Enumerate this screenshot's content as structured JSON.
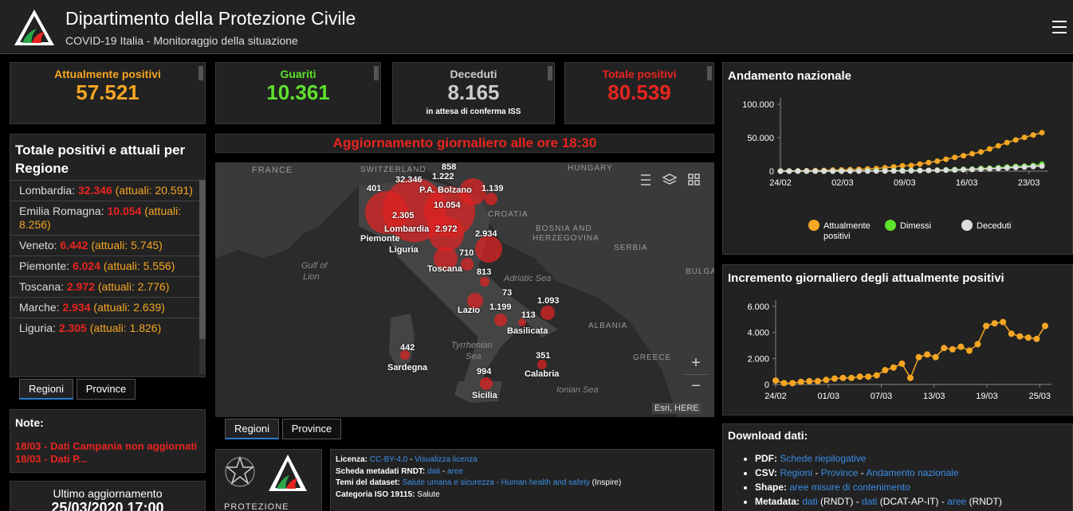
{
  "header": {
    "title": "Dipartimento della Protezione Civile",
    "subtitle": "COVID-19 Italia - Monitoraggio della situazione"
  },
  "kpis": [
    {
      "label": "Attualmente positivi",
      "value": "57.521",
      "color": "#f5a623",
      "note": ""
    },
    {
      "label": "Guariti",
      "value": "10.361",
      "color": "#5ee22c",
      "note": ""
    },
    {
      "label": "Deceduti",
      "value": "8.165",
      "color": "#cccccc",
      "note": "in attesa di conferma ISS"
    },
    {
      "label": "Totale positivi",
      "value": "80.539",
      "color": "#e8241f",
      "note": ""
    }
  ],
  "regions_panel": {
    "title": "Totale positivi e attuali per Regione",
    "actual_prefix": "(attuali: ",
    "actual_suffix": ")",
    "items": [
      {
        "name": "Lombardia",
        "total": "32.346",
        "actual": "20.591"
      },
      {
        "name": "Emilia Romagna",
        "total": "10.054",
        "actual": "8.256"
      },
      {
        "name": "Veneto",
        "total": "6.442",
        "actual": "5.745"
      },
      {
        "name": "Piemonte",
        "total": "6.024",
        "actual": "5.556"
      },
      {
        "name": "Toscana",
        "total": "2.972",
        "actual": "2.776"
      },
      {
        "name": "Marche",
        "total": "2.934",
        "actual": "2.639"
      },
      {
        "name": "Liguria",
        "total": "2.305",
        "actual": "1.826"
      }
    ],
    "tabs": [
      "Regioni",
      "Province"
    ]
  },
  "banner": "Aggiornamento giornaliero alle ore 18:30",
  "map": {
    "countries": [
      "FRANCE",
      "SWITZERLAND",
      "HUNGARY",
      "CROATIA",
      "BOSNIA AND",
      "HERZEGOVINA",
      "SERBIA",
      "BULGA",
      "ALBANIA",
      "GREECE"
    ],
    "seas": [
      "Gulf of",
      "Lion",
      "Adriatic Sea",
      "Tyrrhenian",
      "Sea",
      "Ionian Sea"
    ],
    "labels": [
      "858",
      "1.222",
      "32.346",
      "P.A. Bolzano",
      "1.139",
      "401",
      "10.054",
      "2.305",
      "Lombardia",
      "2.972",
      "Piemonte",
      "2.934",
      "Liguria",
      "710",
      "Toscana",
      "813",
      "73",
      "Lazio",
      "1.199",
      "1.093",
      "113",
      "Basilicata",
      "442",
      "Sardegna",
      "351",
      "994",
      "Calabria",
      "Sicilia"
    ],
    "attribution": "Esri, HERE",
    "zoom_in": "+",
    "zoom_out": "−",
    "tabs": [
      "Regioni",
      "Province"
    ]
  },
  "notes": {
    "title": "Note:",
    "lines": [
      "18/03 - Dati Campania non aggiornati",
      "18/03 - Dati P..."
    ]
  },
  "last_update": {
    "label": "Ultimo aggiornamento",
    "value": "25/03/2020 17:00"
  },
  "logo_text": "PROTEZIONE CIVILE",
  "metadata": {
    "rows": [
      {
        "label": "Licenza:",
        "parts": [
          "CC-BY-4.0",
          " - ",
          "Visualizza licenza"
        ]
      },
      {
        "label": "Scheda metadati RNDT:",
        "parts": [
          "dati",
          " - ",
          "aree"
        ]
      },
      {
        "label": "Temi del dataset:",
        "parts": [
          "Salute umana e sicurezza - Human health and safety",
          " (Inspire)",
          ""
        ]
      },
      {
        "label": "Categoria ISO 19115:",
        "parts": [
          "",
          " Salute",
          ""
        ]
      }
    ]
  },
  "chart1": {
    "title": "Andamento nazionale",
    "legend": [
      "Attualmente positivi",
      "Dimessi",
      "Deceduti"
    ]
  },
  "chart2": {
    "title": "Incremento giornaliero degli attualmente positivi"
  },
  "downloads": {
    "title": "Download dati:",
    "items": [
      {
        "label": "PDF:",
        "links": [
          "Schede riepilogative"
        ]
      },
      {
        "label": "CSV:",
        "links": [
          "Regioni",
          "Province",
          "Andamento nazionale"
        ]
      },
      {
        "label": "Shape:",
        "links": [
          "aree misure di contenimento"
        ]
      },
      {
        "label": "Metadata:",
        "links": [
          "dati",
          "dati",
          "aree"
        ],
        "extra": [
          "(RNDT)",
          "(DCAT-AP-IT)",
          "(RNDT)"
        ]
      }
    ]
  },
  "chart_data": [
    {
      "type": "line",
      "title": "Andamento nazionale",
      "x_ticks": [
        "24/02",
        "02/03",
        "09/03",
        "16/03",
        "23/03"
      ],
      "y_ticks": [
        "0",
        "50.000",
        "100.000"
      ],
      "ylim": [
        0,
        100000
      ],
      "series": [
        {
          "name": "Attualmente positivi",
          "color": "#f5a623",
          "values": [
            221,
            311,
            385,
            588,
            821,
            1049,
            1577,
            1835,
            2263,
            2706,
            3296,
            3916,
            5061,
            6387,
            7985,
            8514,
            10590,
            12839,
            14955,
            17750,
            20603,
            23073,
            26062,
            28710,
            33190,
            37860,
            42681,
            46638,
            50418,
            54030,
            57521
          ]
        },
        {
          "name": "Dimessi",
          "color": "#5ee22c",
          "values": [
            1,
            1,
            3,
            45,
            46,
            46,
            83,
            149,
            160,
            276,
            414,
            523,
            589,
            622,
            724,
            1004,
            1045,
            1258,
            1439,
            1966,
            2335,
            2749,
            2941,
            4025,
            4440,
            5129,
            6072,
            7024,
            7432,
            8326,
            10361
          ]
        },
        {
          "name": "Deceduti",
          "color": "#dddddd",
          "values": [
            7,
            10,
            12,
            17,
            21,
            29,
            34,
            52,
            79,
            107,
            148,
            197,
            233,
            366,
            463,
            631,
            827,
            1016,
            1266,
            1441,
            1809,
            2158,
            2503,
            2978,
            3405,
            4032,
            4825,
            5476,
            6077,
            6820,
            7503
          ]
        }
      ]
    },
    {
      "type": "line",
      "title": "Incremento giornaliero degli attualmente positivi",
      "x_ticks": [
        "24/02",
        "01/03",
        "07/03",
        "13/03",
        "19/03",
        "25/03"
      ],
      "y_ticks": [
        "0",
        "2.000",
        "4.000",
        "6.000"
      ],
      "ylim": [
        0,
        6000
      ],
      "series": [
        {
          "name": "Incremento",
          "color": "#f5a623",
          "values": [
            300,
            100,
            100,
            200,
            250,
            250,
            350,
            450,
            500,
            500,
            600,
            600,
            700,
            1100,
            1300,
            1600,
            500,
            2100,
            2300,
            2100,
            2800,
            2700,
            2900,
            2600,
            3100,
            4500,
            4700,
            4800,
            3900,
            3700,
            3600,
            3500,
            4500
          ]
        }
      ]
    }
  ]
}
